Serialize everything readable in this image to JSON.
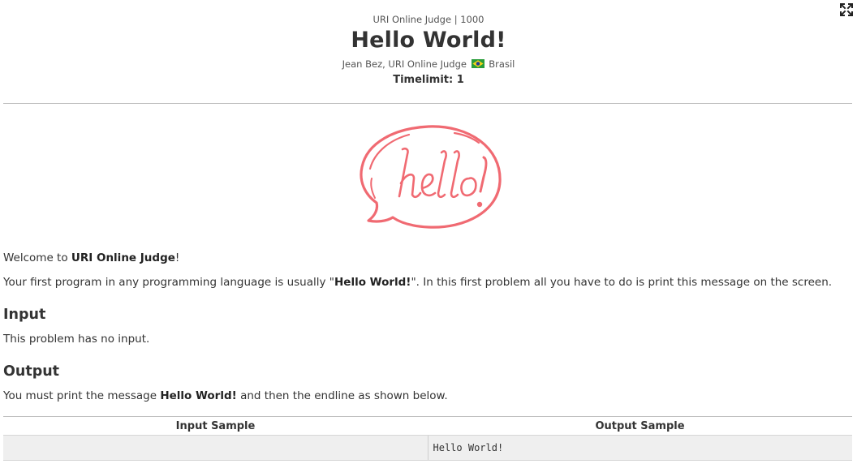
{
  "header": {
    "meta": "URI Online Judge | 1000",
    "title": "Hello World!",
    "authors": "Jean Bez, URI Online Judge",
    "country": "Brasil",
    "timelimit": "Timelimit: 1"
  },
  "illustration": {
    "text": "hello!",
    "color": "#f06a72"
  },
  "icons": {
    "expand": "fullscreen-expand-icon",
    "flag": "brazil-flag-icon"
  },
  "welcome": {
    "prefix": "Welcome to ",
    "bold": "URI Online Judge",
    "suffix": "!"
  },
  "intro": {
    "prefix": "Your first program in any programming language is usually \"",
    "bold": "Hello World!",
    "suffix": "\". In this first problem all you have to do is print this message on the screen."
  },
  "input": {
    "heading": "Input",
    "text": "This problem has no input."
  },
  "output": {
    "heading": "Output",
    "prefix": "You must print the message ",
    "bold": "Hello World!",
    "suffix": " and then the endline as shown below."
  },
  "samples": {
    "input_header": "Input Sample",
    "output_header": "Output Sample",
    "input_value": "",
    "output_value": "Hello World!"
  }
}
